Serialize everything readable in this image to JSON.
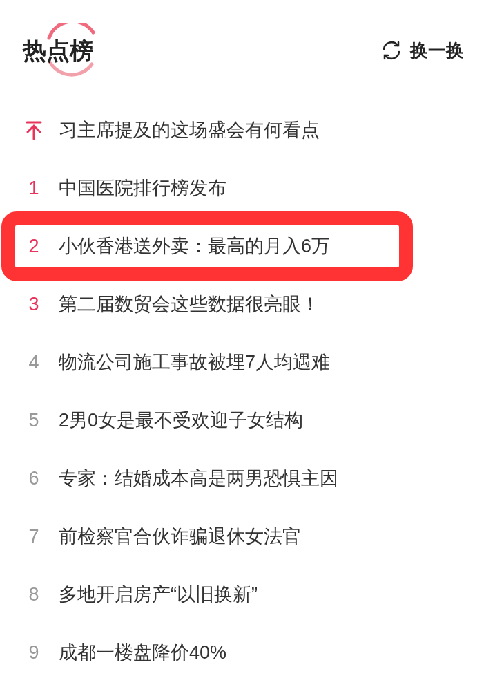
{
  "title": "热点榜",
  "refresh": {
    "label": "换一换"
  },
  "items": [
    {
      "kind": "pinned",
      "text": "习主席提及的这场盛会有何看点",
      "highlighted": false
    },
    {
      "kind": "top",
      "rank": "1",
      "text": "中国医院排行榜发布",
      "highlighted": false
    },
    {
      "kind": "top",
      "rank": "2",
      "text": "小伙香港送外卖：最高的月入6万",
      "highlighted": true
    },
    {
      "kind": "top",
      "rank": "3",
      "text": "第二届数贸会这些数据很亮眼！",
      "highlighted": false
    },
    {
      "kind": "normal",
      "rank": "4",
      "text": "物流公司施工事故被埋7人均遇难",
      "highlighted": false
    },
    {
      "kind": "normal",
      "rank": "5",
      "text": "2男0女是最不受欢迎子女结构",
      "highlighted": false
    },
    {
      "kind": "normal",
      "rank": "6",
      "text": "专家：结婚成本高是两男恐惧主因",
      "highlighted": false
    },
    {
      "kind": "normal",
      "rank": "7",
      "text": "前检察官合伙诈骗退休女法官",
      "highlighted": false
    },
    {
      "kind": "normal",
      "rank": "8",
      "text": "多地开启房产“以旧换新”",
      "highlighted": false
    },
    {
      "kind": "normal",
      "rank": "9",
      "text": "成都一楼盘降价40%",
      "highlighted": false
    }
  ]
}
